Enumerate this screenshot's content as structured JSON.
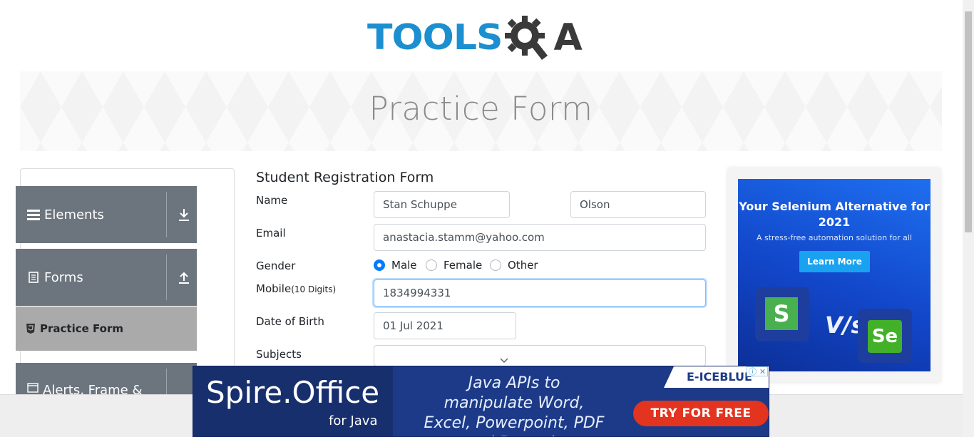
{
  "logo": {
    "text_left": "TOOLS",
    "text_right": "A"
  },
  "banner": {
    "title": "Practice Form"
  },
  "sidebar": {
    "groups": [
      {
        "label": "Elements",
        "icon": "hamburger-icon",
        "arrow": "download-arrow-icon"
      },
      {
        "label": "Forms",
        "icon": "document-icon",
        "arrow": "upload-arrow-icon"
      },
      {
        "label": "Alerts, Frame &",
        "icon": "window-icon"
      }
    ],
    "active_item": {
      "label": "Practice Form",
      "icon": "html5-icon"
    }
  },
  "form": {
    "title": "Student Registration Form",
    "labels": {
      "name": "Name",
      "email": "Email",
      "gender": "Gender",
      "mobile": "Mobile",
      "mobile_hint": "(10 Digits)",
      "dob": "Date of Birth",
      "subjects": "Subjects"
    },
    "first_name": "Stan Schuppe",
    "last_name": "Olson",
    "email": "anastacia.stamm@yahoo.com",
    "gender_options": [
      {
        "label": "Male",
        "checked": true
      },
      {
        "label": "Female",
        "checked": false
      },
      {
        "label": "Other",
        "checked": false
      }
    ],
    "mobile": "1834994331",
    "dob": "01 Jul 2021",
    "subjects": ""
  },
  "ad_right": {
    "headline": "Your Selenium Alternative for 2021",
    "subline": "A stress-free automation solution for all",
    "button": "Learn More",
    "vs": "V/s",
    "tile_left": "S",
    "tile_right": "Se"
  },
  "ad_bottom": {
    "brand": "Spire.Office",
    "brand_sub": "for Java",
    "tagline": "Java APIs to manipulate Word, Excel, Powerpoint, PDF and Barcode",
    "button": "TRY FOR FREE",
    "logo": "E-ICEBLUE",
    "close_icons": [
      "info-icon",
      "close-icon"
    ]
  },
  "colors": {
    "brand_blue": "#1b8fd0",
    "sidebar_group": "#6c757d",
    "active_item": "#aaaaaa",
    "radio_checked": "#007bff"
  }
}
